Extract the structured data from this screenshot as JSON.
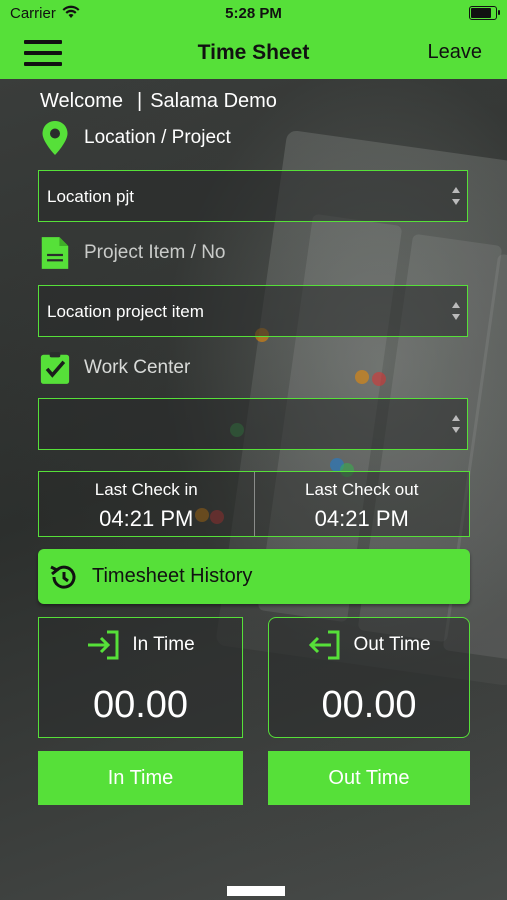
{
  "status_bar": {
    "carrier": "Carrier",
    "time": "5:28 PM"
  },
  "nav": {
    "title": "Time Sheet",
    "leave_label": "Leave",
    "menu_icon": "hamburger-menu-icon"
  },
  "welcome": {
    "label": "Welcome",
    "separator": "|",
    "user_name": "Salama Demo"
  },
  "location": {
    "label": "Location / Project",
    "icon": "location-pin-icon",
    "selected": "Location pjt"
  },
  "project_item": {
    "label": "Project Item / No",
    "icon": "document-icon",
    "selected": "Location project item"
  },
  "work_center": {
    "label": "Work Center",
    "icon": "clipboard-check-icon",
    "selected": ""
  },
  "last_check": {
    "in_label": "Last Check in",
    "in_time": "04:21 PM",
    "out_label": "Last Check out",
    "out_time": "04:21 PM"
  },
  "history": {
    "label": "Timesheet History",
    "icon": "history-icon"
  },
  "in_time": {
    "label": "In Time",
    "value": "00.00",
    "icon": "sign-in-icon"
  },
  "out_time": {
    "label": "Out Time",
    "value": "00.00",
    "icon": "sign-out-icon"
  },
  "buttons": {
    "in_label": "In Time",
    "out_label": "Out Time"
  },
  "colors": {
    "accent": "#56e039",
    "text": "#ffffff",
    "bar_text": "#111111"
  }
}
